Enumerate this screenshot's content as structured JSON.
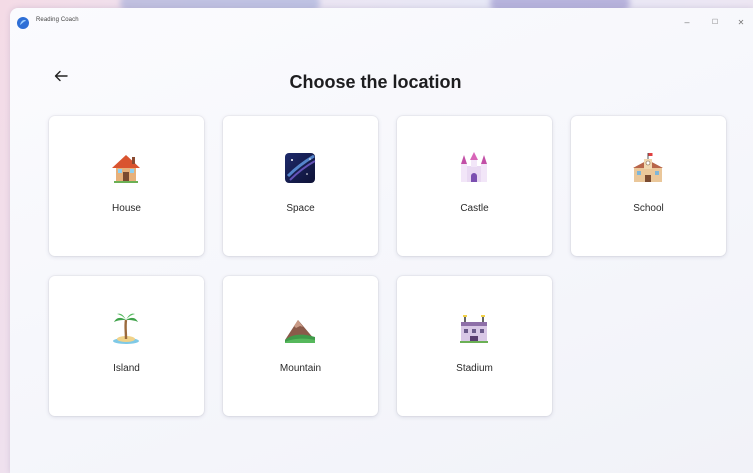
{
  "window": {
    "app_title": "Reading Coach",
    "minimize_glyph": "–",
    "maximize_glyph": "☐",
    "close_glyph": "✕"
  },
  "page": {
    "title": "Choose the location"
  },
  "locations": [
    {
      "label": "House",
      "icon": "house-icon"
    },
    {
      "label": "Space",
      "icon": "space-icon"
    },
    {
      "label": "Castle",
      "icon": "castle-icon"
    },
    {
      "label": "School",
      "icon": "school-icon"
    },
    {
      "label": "Island",
      "icon": "island-icon"
    },
    {
      "label": "Mountain",
      "icon": "mountain-icon"
    },
    {
      "label": "Stadium",
      "icon": "stadium-icon"
    }
  ]
}
